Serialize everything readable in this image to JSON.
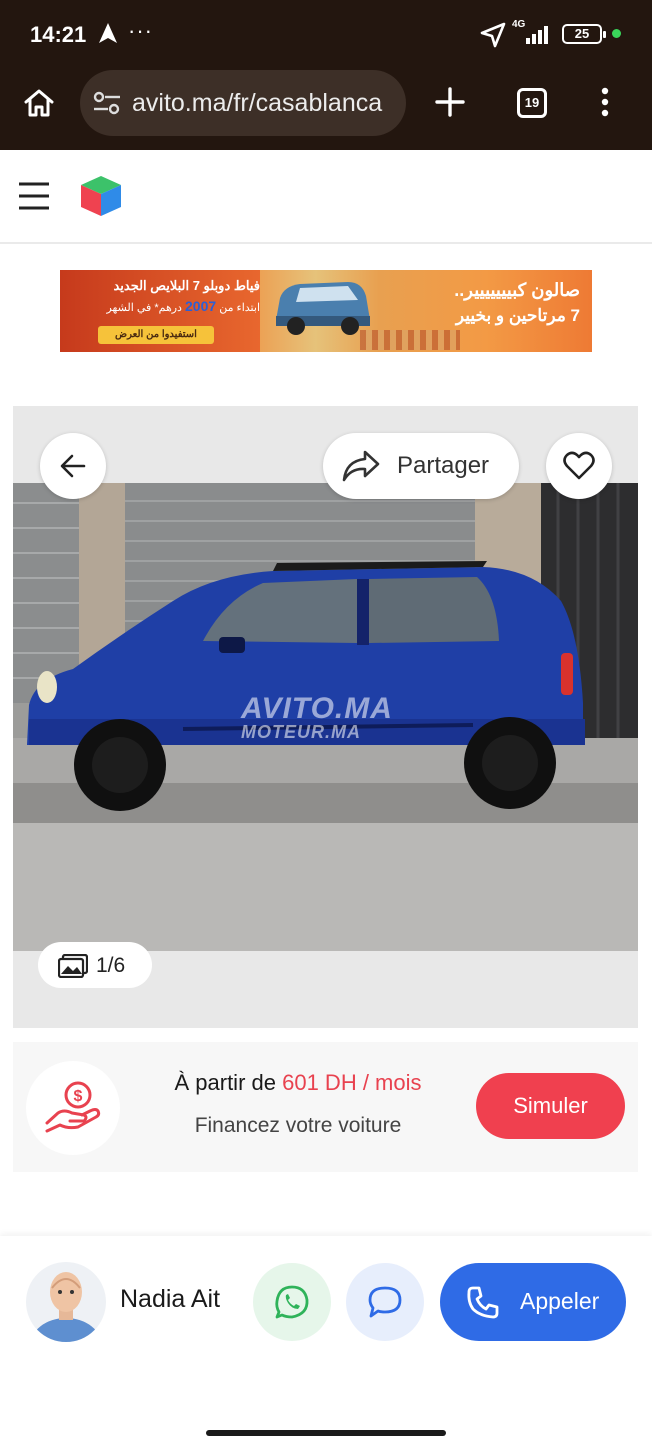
{
  "status_bar": {
    "time": "14:21",
    "dots": "···",
    "network": "4G",
    "battery": "25",
    "icons": [
      "navigation-arrow-icon",
      "location-icon",
      "signal-icon",
      "battery-icon"
    ]
  },
  "browser": {
    "url": "avito.ma/fr/casablanca",
    "tab_count": "19",
    "icons": [
      "home-icon",
      "site-settings-icon",
      "new-tab-icon",
      "tab-switcher-icon",
      "more-menu-icon"
    ]
  },
  "site_header": {
    "icons": [
      "hamburger-menu-icon",
      "avito-logo"
    ]
  },
  "ad_banner": {
    "headline_left": "فياط دوبلو 7 البلايص الجديد",
    "price_line_prefix": "ابتداء من",
    "price_value": "2007",
    "price_line_suffix": "درهم* في الشهر",
    "cta": "استفيدوا من العرض",
    "headline_right_1": "صالون كبييييييير..",
    "headline_right_2": "7 مرتاحين و بخيير"
  },
  "gallery": {
    "share_label": "Partager",
    "photo_counter": "1/6",
    "watermark_line1": "AVITO.MA",
    "watermark_line2": "MOTEUR.MA",
    "icons": [
      "back-arrow-icon",
      "share-icon",
      "heart-icon",
      "photos-icon"
    ],
    "car_color": "#1f3fa6"
  },
  "financing": {
    "prefix": "À partir de",
    "amount": "601 DH / mois",
    "subtitle": "Financez votre voiture",
    "button": "Simuler",
    "accent_color": "#e8424f"
  },
  "contact": {
    "seller_name": "Nadia Ait",
    "call_label": "Appeler",
    "icons": [
      "avatar",
      "whatsapp-icon",
      "chat-icon",
      "phone-icon"
    ],
    "call_color": "#2f6be6"
  }
}
